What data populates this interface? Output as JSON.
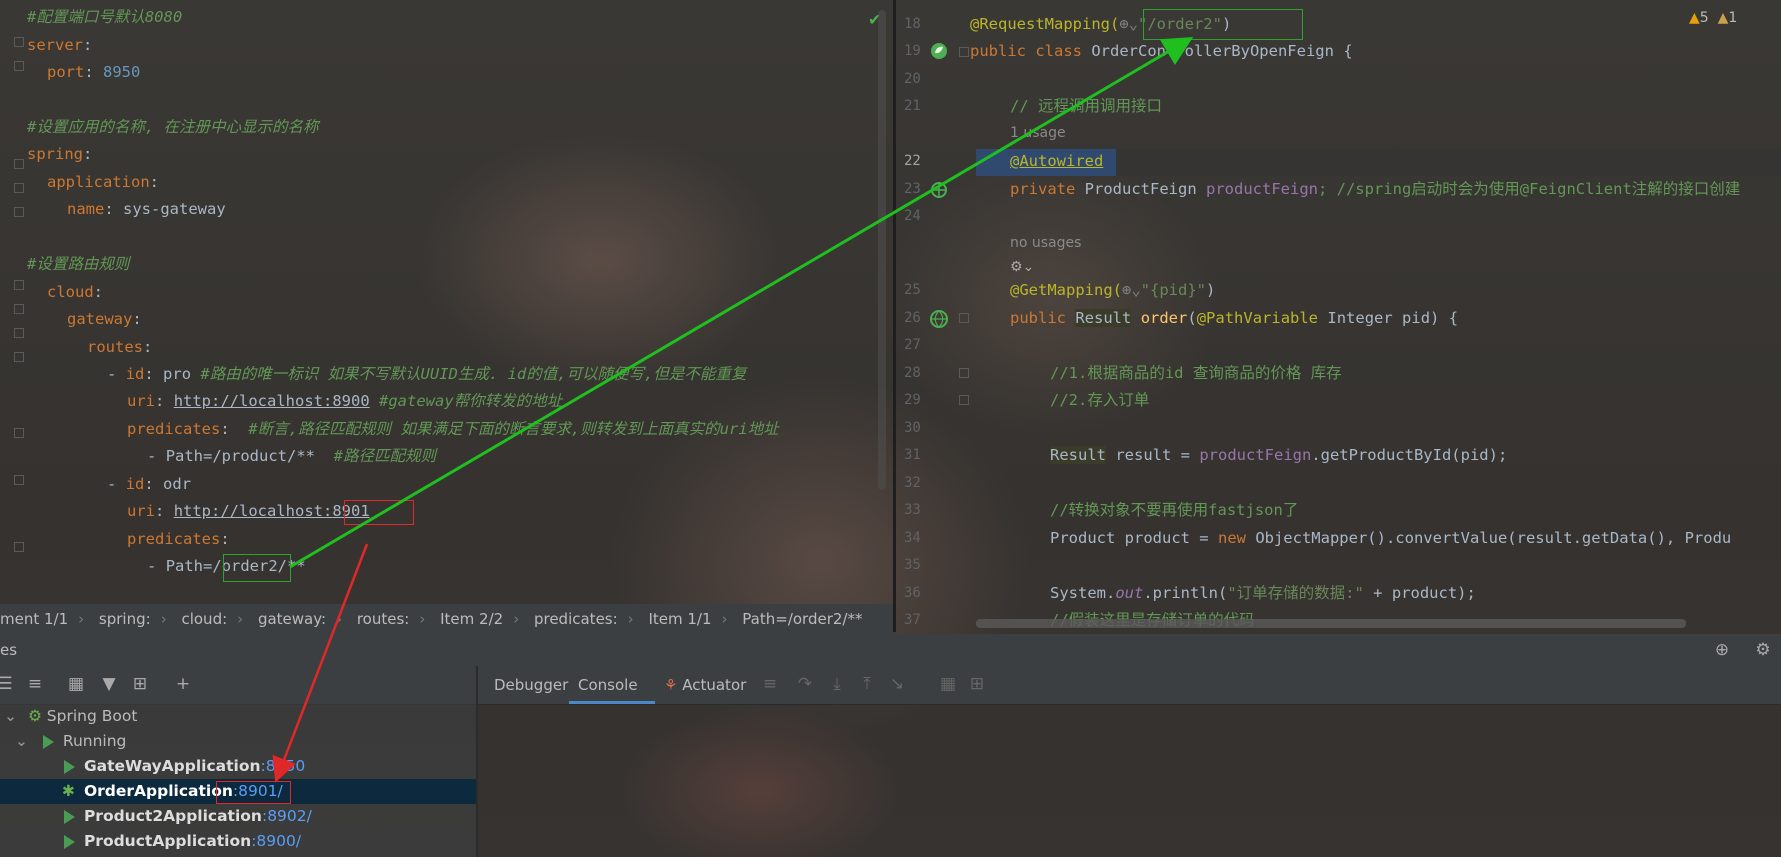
{
  "yaml": {
    "lines": [
      {
        "text": "#配置端口号默认8080"
      },
      {
        "key": "server"
      },
      {
        "key": "port",
        "value": "8950"
      },
      {
        "text": ""
      },
      {
        "text": "#设置应用的名称, 在注册中心显示的名称"
      },
      {
        "key": "spring"
      },
      {
        "key": "application"
      },
      {
        "key": "name",
        "value": "sys-gateway"
      },
      {
        "text": ""
      },
      {
        "text": "#设置路由规则"
      },
      {
        "key": "cloud"
      },
      {
        "key": "gateway"
      },
      {
        "key": "routes"
      },
      {
        "key": "id",
        "value": "pro",
        "comment": "#路由的唯一标识 如果不写默认UUID生成. id的值,可以随便写,但是不能重复"
      },
      {
        "key": "uri",
        "value": "http://localhost:8900",
        "comment": "#gateway帮你转发的地址"
      },
      {
        "key": "predicates",
        "comment": "#断言,路径匹配规则 如果满足下面的断言要求,则转发到上面真实的uri地址"
      },
      {
        "key": "Path=/product/**",
        "comment": "#路径匹配规则"
      },
      {
        "key": "id",
        "value": "odr"
      },
      {
        "key": "uri",
        "value_a": "http://localhost:",
        "value_b": "8901"
      },
      {
        "key": "predicates"
      },
      {
        "key": "Path=/order2/**",
        "value_a": "Path=",
        "value_b": "/order2/",
        "value_c": "**"
      }
    ],
    "colon": ":",
    "dash": "-"
  },
  "breadcrumb": [
    "ment 1/1",
    "spring:",
    "cloud:",
    "gateway:",
    "routes:",
    "Item 2/2",
    "predicates:",
    "Item 1/1",
    "Path=/order2/**"
  ],
  "java": {
    "line_numbers": [
      "18",
      "19",
      "20",
      "21",
      "",
      "22",
      "23",
      "24",
      "",
      "",
      "25",
      "26",
      "27",
      "28",
      "29",
      "30",
      "31",
      "32",
      "33",
      "34",
      "35",
      "36",
      "37"
    ],
    "mapping_anno": "@RequestMapping(",
    "mapping_path": "\"/order2\"",
    "mapping_close": ")",
    "class_kw": "public class",
    "class_name": "OrderControllerByOpenFeign",
    "brace_open": "{",
    "comment_remote": "// 远程调用调用接口",
    "one_usage": "1 usage",
    "autowired": "@Autowired",
    "private_kw": "private",
    "field_type": "ProductFeign",
    "field_name": "productFeign",
    "field_comment": "; //spring启动时会为使用@FeignClient注解的接口创建",
    "no_usages": "no usages",
    "getmapping": "@GetMapping(",
    "getmapping_path": "\"{pid}\"",
    "getmapping_close": ")",
    "public_kw": "public",
    "ret_type": "Result",
    "method_name": "order",
    "param_anno": "@PathVariable",
    "param_rest": "Integer pid) {",
    "c1": "//1.根据商品的id 查询商品的价格 库存",
    "c2": "//2.存入订单",
    "l31_type": "Result",
    "l31_rest": " result = ",
    "l31_field": "productFeign",
    "l31_call": ".getProductById(pid);",
    "c3": "//转换对象不要再使用fastjson了",
    "l34_a": "Product product = ",
    "l34_new": "new",
    "l34_b": " ObjectMapper().convertValue(result.getData(), Produ",
    "l36_a": "System.",
    "l36_out": "out",
    "l36_b": ".println(",
    "l36_str": "\"订单存储的数据:\"",
    "l36_c": " + product);",
    "c4": "//假装这里是存储订单的代码"
  },
  "warnings": {
    "warn_count": "5",
    "weak_count": "1"
  },
  "tool_bar": {
    "title": "es"
  },
  "console": {
    "tabs": [
      "Debugger",
      "Console",
      "Actuator"
    ]
  },
  "services": {
    "root": "Spring Boot",
    "group": "Running",
    "apps": [
      {
        "name": "GateWayApplication",
        "port": ":8950"
      },
      {
        "name": "OrderApplication",
        "port": ":8901/"
      },
      {
        "name": "Product2Application",
        "port": ":8902/"
      },
      {
        "name": "ProductApplication",
        "port": ":8900/"
      }
    ]
  },
  "colors": {
    "accent": "#4a88c7",
    "green_box": "#2ea32e",
    "red_box": "#e02828",
    "keyword": "#cc7832"
  }
}
